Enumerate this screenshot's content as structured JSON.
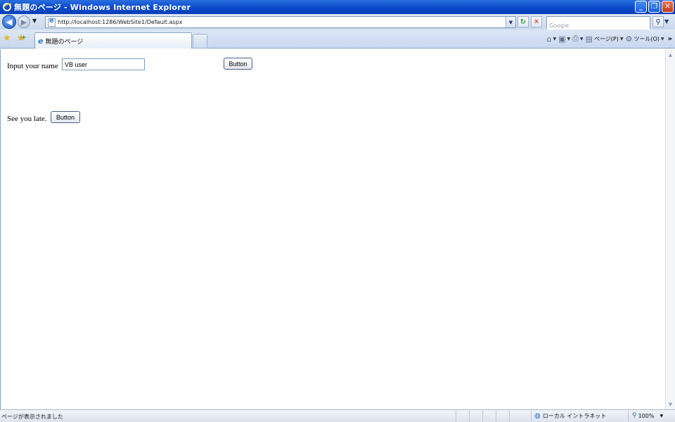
{
  "window": {
    "title": "無題のページ - Windows Internet Explorer",
    "minimize": "_",
    "restore": "❐",
    "close": "✕"
  },
  "addressbar": {
    "url": "http://localhost:1286/WebSite1/Default.aspx",
    "search_placeholder": "Google"
  },
  "tabs": {
    "active_label": "無題のページ"
  },
  "command_bar": {
    "page_label": "ページ(P)",
    "tools_label": "ツール(O)"
  },
  "form": {
    "name_label": "Input your name",
    "name_value": "VB user",
    "button1_label": "Button",
    "bye_label": "See you late.",
    "button2_label": "Button"
  },
  "statusbar": {
    "status": "ページが表示されました",
    "zone": "ローカル イントラネット",
    "zoom": "100%"
  },
  "colors": {
    "titlebar": "#0a48c8",
    "chrome": "#dce6f5",
    "close_button": "#c2391a"
  },
  "icons": [
    "ie-logo-icon",
    "back-arrow-icon",
    "forward-arrow-icon",
    "refresh-icon",
    "stop-icon",
    "search-icon",
    "favorites-star-icon",
    "add-favorites-icon",
    "home-icon",
    "feeds-icon",
    "print-icon",
    "page-icon",
    "tools-gear-icon",
    "globe-icon",
    "zoom-icon"
  ]
}
